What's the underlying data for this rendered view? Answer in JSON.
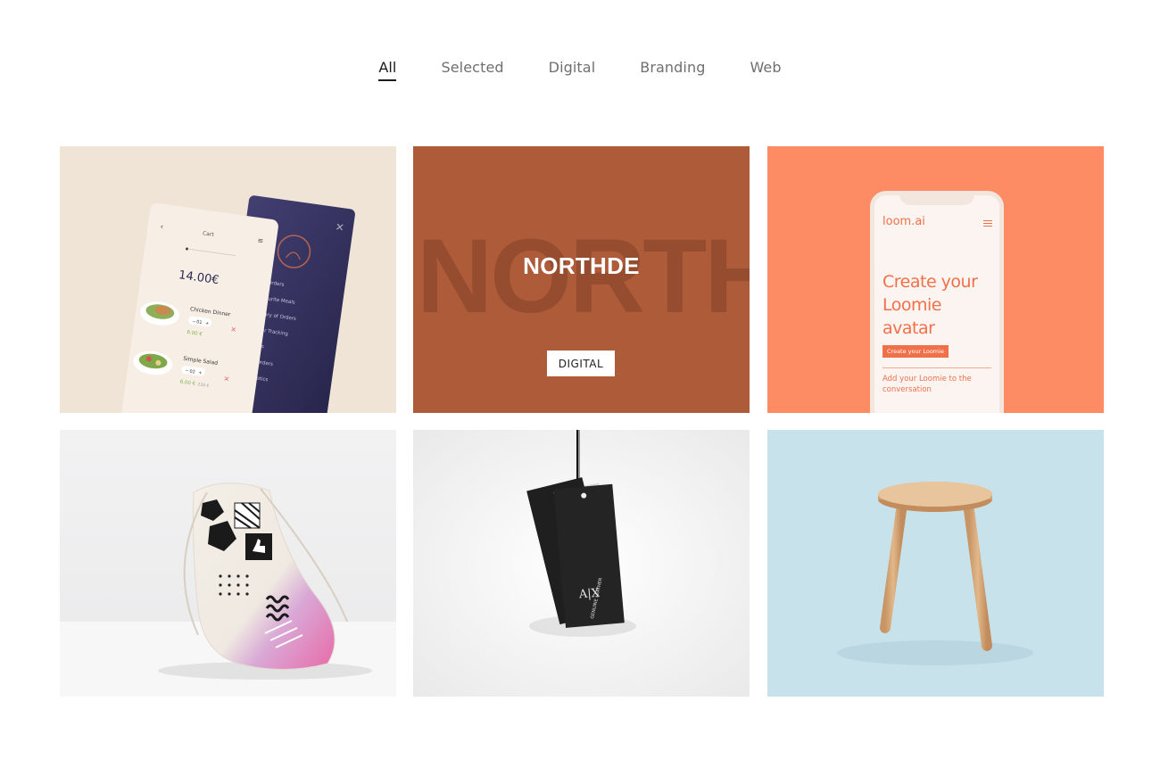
{
  "filters": [
    {
      "label": "All",
      "active": true
    },
    {
      "label": "Selected",
      "active": false
    },
    {
      "label": "Digital",
      "active": false
    },
    {
      "label": "Branding",
      "active": false
    },
    {
      "label": "Web",
      "active": false
    }
  ],
  "tiles": [
    {
      "name": "food-app-mockup",
      "cart_title": "Cart",
      "total": "14.00€",
      "items": [
        {
          "name": "Chicken Dinner",
          "qty": "01",
          "price": "6.00 €"
        },
        {
          "name": "Simple Salad",
          "qty": "02",
          "price": "6.00 €",
          "old_price": "220 €"
        }
      ],
      "menu_items": [
        "My Orders",
        "Favourite Meals",
        "History of Orders",
        "Order Tracking",
        "Chefs",
        "My Orders",
        "Statistics"
      ],
      "colors": {
        "bg": "#f0e4d6",
        "dark": "#2d2a55"
      }
    },
    {
      "name": "northde-project",
      "background_word": "NORTHDE",
      "title": "NORTHDE",
      "tag": "DIGITAL",
      "colors": {
        "bg": "#ae5b39"
      }
    },
    {
      "name": "loom-ai-mockup",
      "logo": "loom.ai",
      "headline": "Create your Loomie avatar",
      "cta": "Create your Loomie",
      "subtext": "Add your Loomie to the conversation",
      "colors": {
        "bg": "#fd8c65",
        "accent": "#f0704a"
      }
    },
    {
      "name": "drawstring-bag-photo",
      "colors": {
        "bg": "#efeff0"
      }
    },
    {
      "name": "hang-tag-photo",
      "brand_mark": "A|X",
      "label": "GENUINE LEATHER",
      "colors": {
        "bg": "#f2f2f2",
        "tag": "#1f1f1f"
      }
    },
    {
      "name": "wooden-stool-photo",
      "colors": {
        "bg": "#c8e2ec",
        "wood": "#d9a877"
      }
    }
  ]
}
